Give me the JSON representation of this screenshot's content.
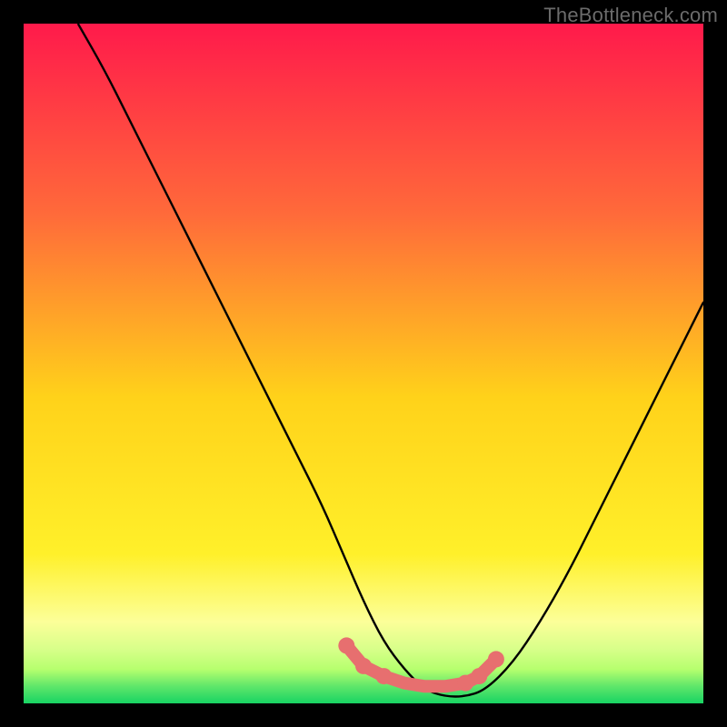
{
  "watermark": "TheBottleneck.com",
  "colors": {
    "top": "#ff1a4b",
    "mid_upper": "#ff8a3a",
    "mid": "#ffd21a",
    "mid_lower": "#fff02a",
    "pale": "#fcff99",
    "green_light": "#b6ff6e",
    "green_mid": "#5fe66a",
    "green": "#18d463",
    "black": "#000000",
    "curve": "#000000",
    "marker": "#e76f6f"
  },
  "chart_data": {
    "type": "line",
    "title": "",
    "xlabel": "",
    "ylabel": "",
    "xlim": [
      0,
      100
    ],
    "ylim": [
      0,
      100
    ],
    "series": [
      {
        "name": "bottleneck-curve",
        "x": [
          8,
          12,
          16,
          20,
          24,
          28,
          32,
          36,
          40,
          44,
          47,
          50,
          53,
          56,
          59,
          62,
          65,
          68,
          72,
          76,
          80,
          84,
          88,
          92,
          96,
          100
        ],
        "y": [
          100,
          93,
          85,
          77,
          69,
          61,
          53,
          45,
          37,
          29,
          22,
          15,
          9,
          5,
          2,
          1,
          1,
          2,
          6,
          12,
          19,
          27,
          35,
          43,
          51,
          59
        ]
      }
    ],
    "markers": {
      "name": "highlight-band",
      "points_x": [
        47.5,
        50,
        53,
        56,
        59,
        62,
        65,
        67,
        69.5
      ],
      "points_y": [
        8.5,
        5.5,
        4,
        3,
        2.5,
        2.5,
        3,
        4,
        6.5
      ]
    }
  }
}
